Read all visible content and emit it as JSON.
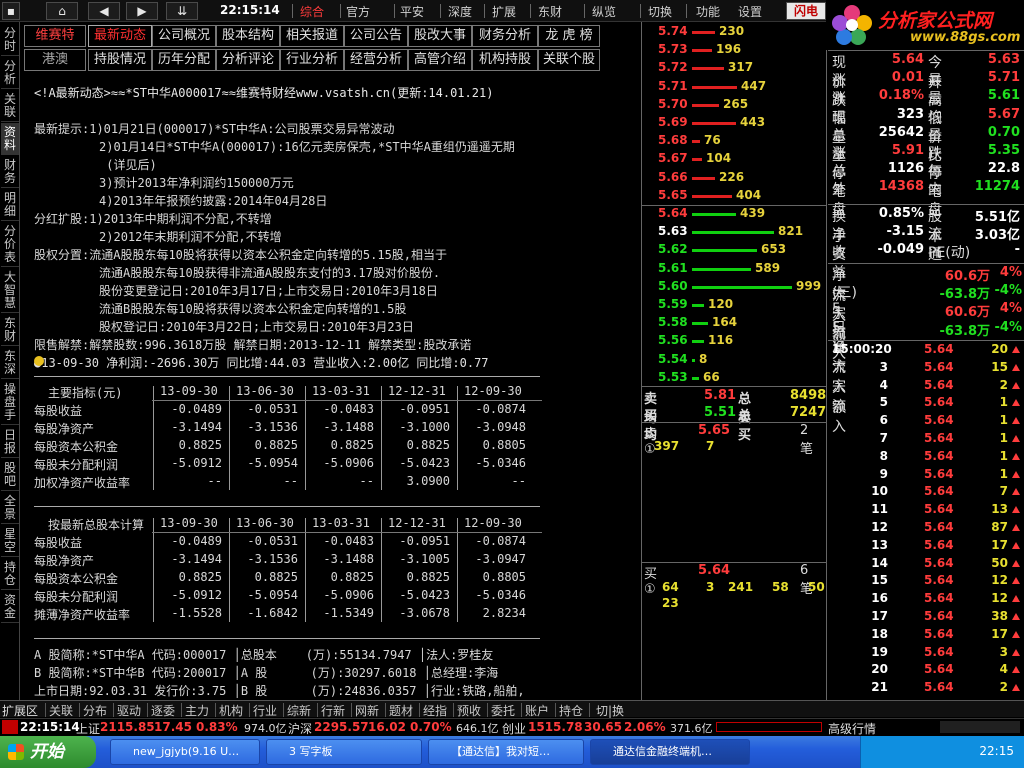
{
  "toolbar": {
    "time": "22:15:14",
    "menus": [
      "综合",
      "官方",
      "平安",
      "深度",
      "扩展",
      "东财",
      "纵览",
      "切换",
      "功能",
      "设置"
    ],
    "flash_label": "闪电"
  },
  "logo": {
    "name": "分析家公式网",
    "url": "www.88gs.com",
    "subtitle": "分析家公式网"
  },
  "left_tabs": [
    "分时",
    "分析",
    "关联",
    "资料",
    "财务",
    "明细",
    "分价表",
    "大智慧",
    "东财",
    "东深",
    "操盘手",
    "日报",
    "股吧",
    "全景",
    "星空",
    "持仓",
    "资金"
  ],
  "f10": {
    "row1_left": "维赛特",
    "row2_left": "港澳",
    "row1": [
      "最新动态",
      "公司概况",
      "股本结构",
      "相关报道",
      "公司公告",
      "股改大事",
      "财务分析",
      "龙 虎 榜"
    ],
    "row2": [
      "持股情况",
      "历年分配",
      "分析评论",
      "行业分析",
      "经营分析",
      "高管介绍",
      "机构持股",
      "关联个股"
    ]
  },
  "content": {
    "header": "<!A最新动态>≈≈*ST中华A000017≈≈维赛特财经www.vsatsh.cn(更新:14.01.21)",
    "lines": [
      "最新提示:1)01月21日(000017)*ST中华A:公司股票交易异常波动",
      "         2)01月14日*ST中华A(000017):16亿元卖房保壳,*ST中华A重组仍遥遥无期",
      "          (详见后)",
      "         3)预计2013年净利润约150000万元",
      "         4)2013年年报预约披露:2014年04月28日",
      "分红扩股:1)2013年中期利润不分配,不转增",
      "         2)2012年末期利润不分配,不转增",
      "股权分置:流通A股股东每10股将获得以资本公积金定向转增的5.15股,相当于",
      "         流通A股股东每10股获得非流通A股股东支付的3.17股对价股份.",
      "         股份变更登记日:2010年3月17日;上市交易日:2010年3月18日",
      "         流通B股股东每10股将获得以资本公积金定向转增的1.5股",
      "         股权登记日:2010年3月22日;上市交易日:2010年3月23日",
      "限售解禁:解禁股数:996.3618万股 解禁日期:2013-12-11 解禁类型:股改承诺"
    ],
    "summary": "●13-09-30 净利润:-2696.30万 同比增:44.03 营业收入:2.00亿 同比增:0.77",
    "table1_head": [
      "主要指标(元)",
      "13-09-30",
      "13-06-30",
      "13-03-31",
      "12-12-31",
      "12-09-30"
    ],
    "table1": [
      [
        "每股收益",
        "-0.0489",
        "-0.0531",
        "-0.0483",
        "-0.0951",
        "-0.0874"
      ],
      [
        "每股净资产",
        "-3.1494",
        "-3.1536",
        "-3.1488",
        "-3.1000",
        "-3.0948"
      ],
      [
        "每股资本公积金",
        "0.8825",
        "0.8825",
        "0.8825",
        "0.8825",
        "0.8805"
      ],
      [
        "每股未分配利润",
        "-5.0912",
        "-5.0954",
        "-5.0906",
        "-5.0423",
        "-5.0346"
      ],
      [
        "加权净资产收益率",
        "--",
        "--",
        "--",
        "3.0900",
        "--"
      ]
    ],
    "table2_head": [
      "按最新总股本计算",
      "13-09-30",
      "13-06-30",
      "13-03-31",
      "12-12-31",
      "12-09-30"
    ],
    "table2": [
      [
        "每股收益",
        "-0.0489",
        "-0.0531",
        "-0.0483",
        "-0.0951",
        "-0.0874"
      ],
      [
        "每股净资产",
        "-3.1494",
        "-3.1536",
        "-3.1488",
        "-3.1005",
        "-3.0947"
      ],
      [
        "每股资本公积金",
        "0.8825",
        "0.8825",
        "0.8825",
        "0.8825",
        "0.8805"
      ],
      [
        "每股未分配利润",
        "-5.0912",
        "-5.0954",
        "-5.0906",
        "-5.0423",
        "-5.0346"
      ],
      [
        "摊薄净资产收益率",
        "-1.5528",
        "-1.6842",
        "-1.5349",
        "-3.0678",
        "2.8234"
      ]
    ],
    "info": [
      "A 股简称:*ST中华A 代码:000017 │总股本    (万):55134.7947 │法人:罗桂友",
      "B 股简称:*ST中华B 代码:200017 │A 股      (万):30297.6018 │总经理:李海",
      "上市日期:92.03.31 发行价:3.75 │B 股      (万):24836.0357 │行业:铁路,船舶,"
    ]
  },
  "asks": [
    [
      "5.74",
      230
    ],
    [
      "5.73",
      196
    ],
    [
      "5.72",
      317
    ],
    [
      "5.71",
      447
    ],
    [
      "5.70",
      265
    ],
    [
      "5.69",
      443
    ],
    [
      "5.68",
      76
    ],
    [
      "5.67",
      104
    ],
    [
      "5.66",
      226
    ],
    [
      "5.65",
      404
    ]
  ],
  "bids": [
    [
      "5.64",
      439
    ],
    [
      "5.63",
      821
    ],
    [
      "5.62",
      653
    ],
    [
      "5.61",
      589
    ],
    [
      "5.60",
      999
    ],
    [
      "5.59",
      120
    ],
    [
      "5.58",
      164
    ],
    [
      "5.56",
      116
    ],
    [
      "5.54",
      8
    ],
    [
      "5.53",
      66
    ]
  ],
  "book_summary": {
    "sell_avg_label": "卖均",
    "sell_avg": "5.81",
    "total_sell_label": "总卖",
    "total_sell": "8498",
    "buy_avg_label": "买均",
    "buy_avg": "5.51",
    "total_buy_label": "总买",
    "total_buy": "7247"
  },
  "queue": {
    "sell_label": "卖①",
    "sell_price": "5.65",
    "sell_count": "2笔",
    "sell_items": [
      "397",
      "7"
    ],
    "buy_label": "买①",
    "buy_price": "5.64",
    "buy_count": "6笔",
    "buy_items": [
      "64",
      "3",
      "241",
      "58",
      "50",
      "23"
    ]
  },
  "mid_tabs": [
    "队列",
    "分布",
    "龙虎",
    "风向"
  ],
  "quote": [
    [
      "现价",
      "5.64",
      "今开",
      "5.63"
    ],
    [
      "涨跌",
      "0.01",
      "最高",
      "5.71"
    ],
    [
      "涨幅",
      "0.18%",
      "最低",
      "5.61"
    ],
    [
      "现量",
      "323",
      "均价",
      "5.67"
    ],
    [
      "总量",
      "25642",
      "量比",
      "0.70"
    ],
    [
      "涨停",
      "5.91",
      "跌停",
      "5.35"
    ],
    [
      "总笔",
      "1126",
      "每笔",
      "22.8"
    ],
    [
      "外盘",
      "14368",
      "内盘",
      "11274"
    ]
  ],
  "quote2": [
    [
      "换手",
      "0.85%",
      "股本",
      "5.51亿"
    ],
    [
      "净资",
      "-3.15",
      "流通",
      "3.03亿"
    ],
    [
      "收益(三)",
      "-0.049",
      "PE(动)",
      "-"
    ]
  ],
  "flows": [
    [
      "净流入额",
      "60.6万",
      "4%"
    ],
    [
      "大宗流入",
      "-63.8万",
      "-4%"
    ],
    [
      "5日净流入额",
      "60.6万",
      "4%"
    ],
    [
      "5日大宗流入",
      "-63.8万",
      "-4%"
    ]
  ],
  "ticks": [
    [
      "15:00:20",
      "5.64",
      "20"
    ],
    [
      "3",
      "5.64",
      "15"
    ],
    [
      "4",
      "5.64",
      "2"
    ],
    [
      "5",
      "5.64",
      "1"
    ],
    [
      "6",
      "5.64",
      "1"
    ],
    [
      "7",
      "5.64",
      "1"
    ],
    [
      "8",
      "5.64",
      "1"
    ],
    [
      "9",
      "5.64",
      "1"
    ],
    [
      "10",
      "5.64",
      "7"
    ],
    [
      "11",
      "5.64",
      "13"
    ],
    [
      "12",
      "5.64",
      "87"
    ],
    [
      "13",
      "5.64",
      "17"
    ],
    [
      "14",
      "5.64",
      "50"
    ],
    [
      "15",
      "5.64",
      "12"
    ],
    [
      "16",
      "5.64",
      "12"
    ],
    [
      "17",
      "5.64",
      "38"
    ],
    [
      "18",
      "5.64",
      "17"
    ],
    [
      "19",
      "5.64",
      "3"
    ],
    [
      "20",
      "5.64",
      "4"
    ],
    [
      "21",
      "5.64",
      "2"
    ]
  ],
  "right_tabs": [
    "笔",
    "价",
    "细",
    "盘",
    "势",
    "指",
    "值",
    "筹"
  ],
  "bottom_tabs": [
    "扩展区",
    "关联",
    "分布",
    "驱动",
    "逐委",
    "主力",
    "机构",
    "行业",
    "综新",
    "行新",
    "网新",
    "题材",
    "经指",
    "预收",
    "委托",
    "账户",
    "持仓"
  ],
  "bottom_right": "切|换",
  "status": {
    "time": "22:15:14",
    "sh_label": "上证",
    "sh_val": "2115.85",
    "sh_chg": "17.45",
    "sh_pct": "0.83%",
    "sh_amt": "974.0亿",
    "hs_label": "沪深",
    "hs_val": "2295.57",
    "hs_chg": "16.02",
    "hs_pct": "0.70%",
    "hs_amt": "646.1亿",
    "cy_label": "创业",
    "cy_val": "1515.78",
    "cy_chg": "30.65",
    "cy_pct": "2.06%",
    "cy_amt": "371.6亿",
    "right": "高级行情"
  },
  "taskbar": {
    "start": "开始",
    "tasks": [
      "new_jgjyb(9.16 U…",
      "3 写字板",
      "【通达信】我对短…",
      "通达信金融终端机…"
    ],
    "clock": "22:15"
  }
}
